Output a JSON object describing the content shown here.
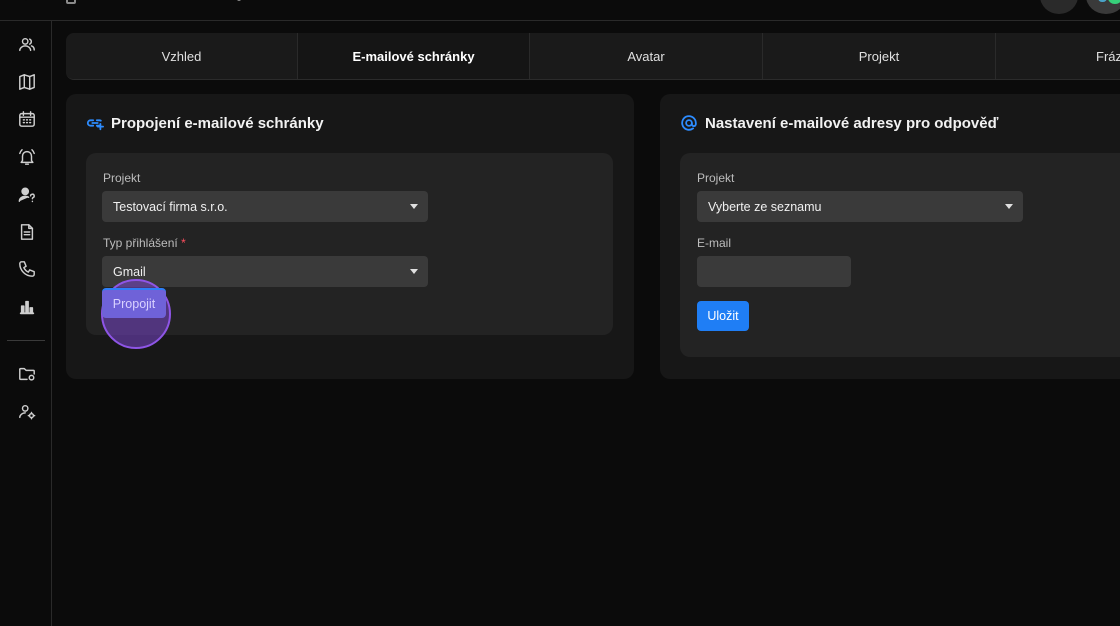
{
  "tabs": [
    {
      "label": "Vzhled"
    },
    {
      "label": "E-mailové schránky"
    },
    {
      "label": "Avatar"
    },
    {
      "label": "Projekt"
    },
    {
      "label": "Fráz"
    }
  ],
  "active_tab": "E-mailové schránky",
  "left_card": {
    "title": "Propojení e-mailové schránky",
    "project_label": "Projekt",
    "project_value": "Testovací firma s.r.o.",
    "login_type_label": "Typ přihlášení",
    "required_mark": "*",
    "login_type_value": "Gmail",
    "connect_button": "Propojit"
  },
  "right_card": {
    "title": "Nastavení e-mailové adresy pro odpověď",
    "project_label": "Projekt",
    "project_value": "Vyberte ze seznamu",
    "email_label": "E-mail",
    "email_value": "",
    "save_button": "Uložit"
  },
  "sidebar_icons": [
    "users-icon",
    "map-icon",
    "calendar-icon",
    "bell-icon",
    "user-question-icon",
    "document-icon",
    "phone-icon",
    "bar-chart-icon",
    "folder-settings-icon",
    "user-settings-icon"
  ],
  "colors": {
    "accent": "#1f7ef5",
    "required": "#ff4d5e",
    "click_indicator": "#8e55e6"
  }
}
